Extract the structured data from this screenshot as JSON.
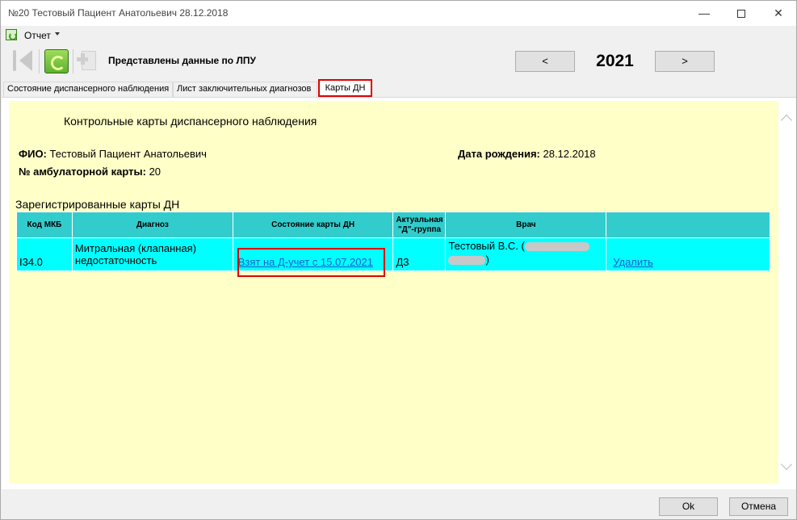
{
  "window": {
    "title": "№20 Тестовый Пациент Анатольевич 28.12.2018",
    "minimize": "—",
    "close": "✕"
  },
  "menu": {
    "report_label": "Отчет"
  },
  "toolbar": {
    "status_label": "Представлены данные по ЛПУ",
    "prev_label": "<",
    "next_label": ">",
    "year": "2021"
  },
  "tabs": [
    {
      "label": "Состояние диспансерного наблюдения"
    },
    {
      "label": "Лист заключительных диагнозов"
    },
    {
      "label": "Карты ДН",
      "active": true
    }
  ],
  "page": {
    "heading": "Контрольные карты диспансерного наблюдения",
    "fio_label": "ФИО:",
    "fio_value": " Тестовый Пациент Анатольевич",
    "dob_label": "Дата рождения:",
    "dob_value": " 28.12.2018",
    "amb_label": "№ амбулаторной карты:",
    "amb_value": " 20",
    "section_title": "Зарегистрированные карты ДН"
  },
  "table": {
    "headers": {
      "code": "Код МКБ",
      "diagnosis": "Диагноз",
      "state": "Состояние карты ДН",
      "group": "Актуальная \"Д\"-группа",
      "doctor": "Врач",
      "action": ""
    },
    "rows": [
      {
        "code": "I34.0",
        "diagnosis": "Митральная (клапанная) недостаточность",
        "state": "Взят на Д-учет с 15.07.2021",
        "group": "Д3",
        "doctor_prefix": "Тестовый В.С. (",
        "doctor_suffix": ")",
        "action": "Удалить"
      }
    ]
  },
  "buttons": {
    "ok": "Ok",
    "cancel": "Отмена"
  },
  "colors": {
    "content_bg": "#ffffc8",
    "table_header_bg": "#33cccc",
    "table_row_bg": "#00ffff",
    "highlight": "#e00000",
    "link": "#1a5fd0"
  }
}
